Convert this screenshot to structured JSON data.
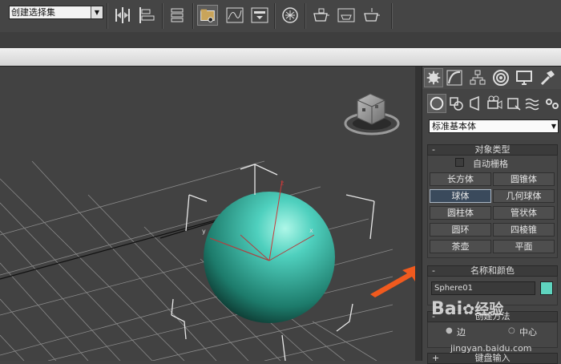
{
  "toolbar": {
    "selection_set_value": "创建选择集",
    "icons": [
      "mirror-icon",
      "align-icon",
      "layer-manager-icon",
      "scene-explorer-icon",
      "curve-editor-icon",
      "schematic-view-icon",
      "material-editor-icon",
      "render-setup-icon",
      "rendered-frame-icon",
      "render-icon"
    ]
  },
  "command_panel": {
    "tabs": [
      "create-tab",
      "modify-tab",
      "hierarchy-tab",
      "motion-tab",
      "display-tab",
      "utilities-tab"
    ],
    "subcategories": [
      "geometry",
      "shapes",
      "lights",
      "cameras",
      "helpers",
      "space-warps",
      "systems"
    ],
    "category_value": "标准基本体",
    "object_type": {
      "title": "对象类型",
      "autogrid_label": "自动栅格",
      "buttons": [
        "长方体",
        "圆锥体",
        "球体",
        "几何球体",
        "圆柱体",
        "管状体",
        "圆环",
        "四棱锥",
        "茶壶",
        "平面"
      ],
      "active_button": "球体"
    },
    "name_color": {
      "title": "名称和颜色",
      "name_value": "Sphere01",
      "color": "#5fd4bf"
    },
    "creation_method": {
      "title": "创建方法",
      "option_left": "边",
      "option_right": "中心"
    },
    "keyboard_entry": {
      "title": "键盘输入"
    },
    "minus_sign": "-",
    "plus_sign": "+"
  },
  "viewport": {
    "axis_labels": {
      "x": "x",
      "y": "y",
      "z": "z"
    },
    "sphere_color": "#4fd0be"
  },
  "watermark": {
    "brand": "Bai",
    "brand2": "经验",
    "url": "jingyan.baidu.com"
  }
}
